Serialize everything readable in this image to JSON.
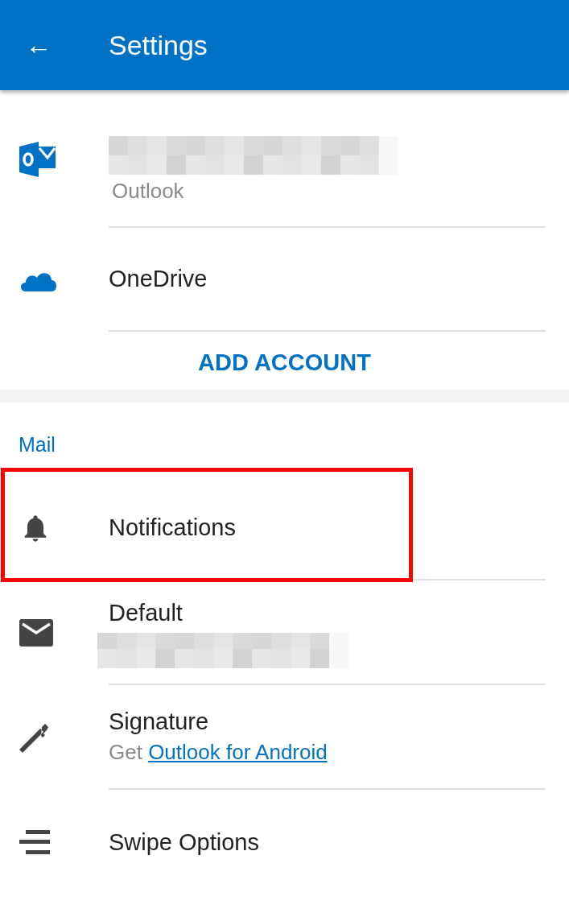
{
  "app_bar": {
    "back": "←",
    "title": "Settings"
  },
  "accounts": [
    {
      "kind": "outlook",
      "title_redacted": true,
      "subtitle": "Outlook"
    },
    {
      "kind": "onedrive",
      "title": "OneDrive"
    }
  ],
  "add_account": "ADD ACCOUNT",
  "mail": {
    "header": "Mail",
    "items": [
      {
        "kind": "notifications",
        "title": "Notifications",
        "highlighted": true
      },
      {
        "kind": "default",
        "title": "Default",
        "subtitle_redacted": true
      },
      {
        "kind": "signature",
        "title": "Signature",
        "subtitle": "Get",
        "link": "Outlook for Android"
      },
      {
        "kind": "swipe",
        "title": "Swipe Options"
      }
    ]
  }
}
